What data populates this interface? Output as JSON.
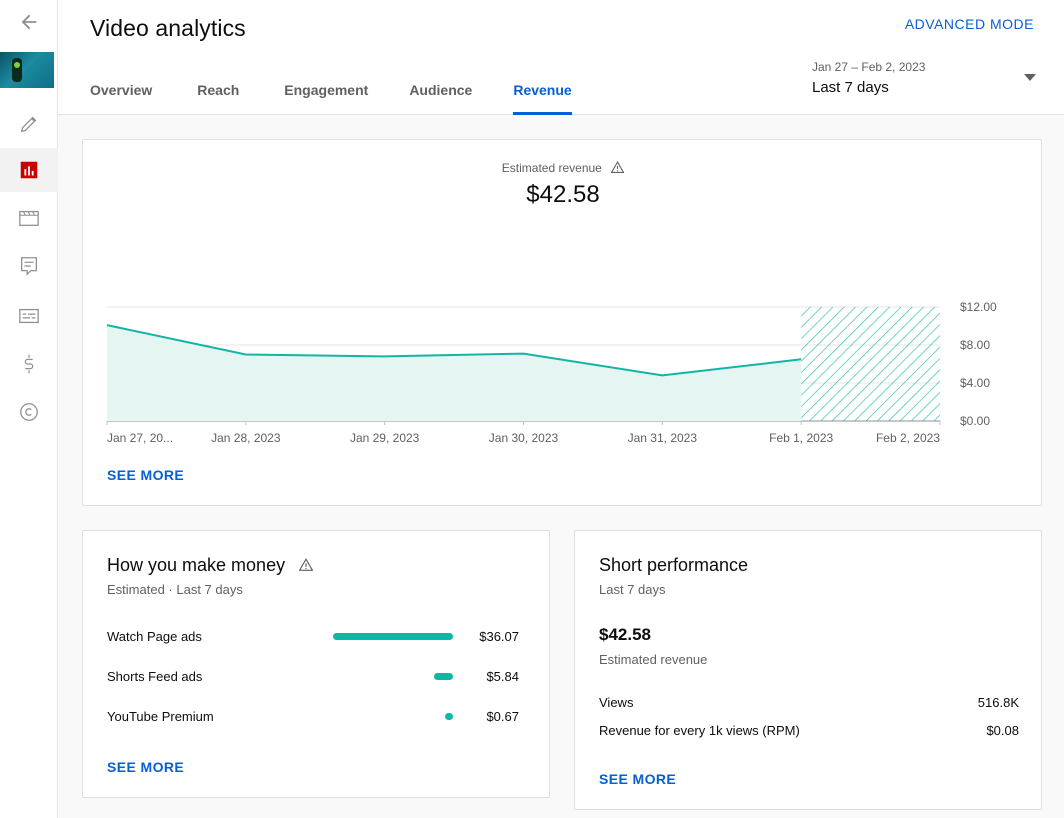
{
  "header": {
    "title": "Video analytics",
    "advanced_mode": "ADVANCED MODE",
    "date_range": "Jan 27 – Feb 2, 2023",
    "date_label": "Last 7 days"
  },
  "tabs": [
    {
      "label": "Overview"
    },
    {
      "label": "Reach"
    },
    {
      "label": "Engagement"
    },
    {
      "label": "Audience"
    },
    {
      "label": "Revenue",
      "active": true
    }
  ],
  "rail": {
    "icons": [
      "back-arrow-icon",
      "video-thumbnail",
      "pencil-icon",
      "analytics-icon",
      "clapperboard-icon",
      "comments-icon",
      "subtitles-icon",
      "dollar-icon",
      "copyright-icon"
    ]
  },
  "revenue_card": {
    "metric_label": "Estimated revenue",
    "metric_value": "$42.58",
    "see_more": "SEE MORE"
  },
  "chart_data": {
    "type": "area",
    "x": [
      "Jan 27, 20...",
      "Jan 28, 2023",
      "Jan 29, 2023",
      "Jan 30, 2023",
      "Jan 31, 2023",
      "Feb 1, 2023",
      "Feb 2, 2023"
    ],
    "values": [
      10.1,
      7.0,
      6.8,
      7.1,
      4.8,
      6.5,
      null
    ],
    "y_ticks": [
      "$0.00",
      "$4.00",
      "$8.00",
      "$12.00"
    ],
    "y_tick_values": [
      0,
      4,
      8,
      12
    ],
    "ylim": [
      0,
      12
    ],
    "partial_period": [
      "Feb 1, 2023",
      "Feb 2, 2023"
    ],
    "grid": true,
    "line_color": "#12b5a5",
    "fill_color": "#e4f5f2"
  },
  "money_card": {
    "title": "How you make money",
    "subtitle": "Estimated · Last 7 days",
    "rows": [
      {
        "label": "Watch Page ads",
        "value": "$36.07",
        "amount": 36.07
      },
      {
        "label": "Shorts Feed ads",
        "value": "$5.84",
        "amount": 5.84
      },
      {
        "label": "YouTube Premium",
        "value": "$0.67",
        "amount": 0.67
      }
    ],
    "see_more": "SEE MORE"
  },
  "short_card": {
    "title": "Short performance",
    "subtitle": "Last 7 days",
    "value": "$42.58",
    "value_label": "Estimated revenue",
    "rows": [
      {
        "label": "Views",
        "value": "516.8K"
      },
      {
        "label": "Revenue for every 1k views (RPM)",
        "value": "$0.08"
      }
    ],
    "see_more": "SEE MORE"
  },
  "colors": {
    "accent": "#065fd4",
    "teal": "#12b5a5",
    "analytics_icon": "#cc0000"
  }
}
